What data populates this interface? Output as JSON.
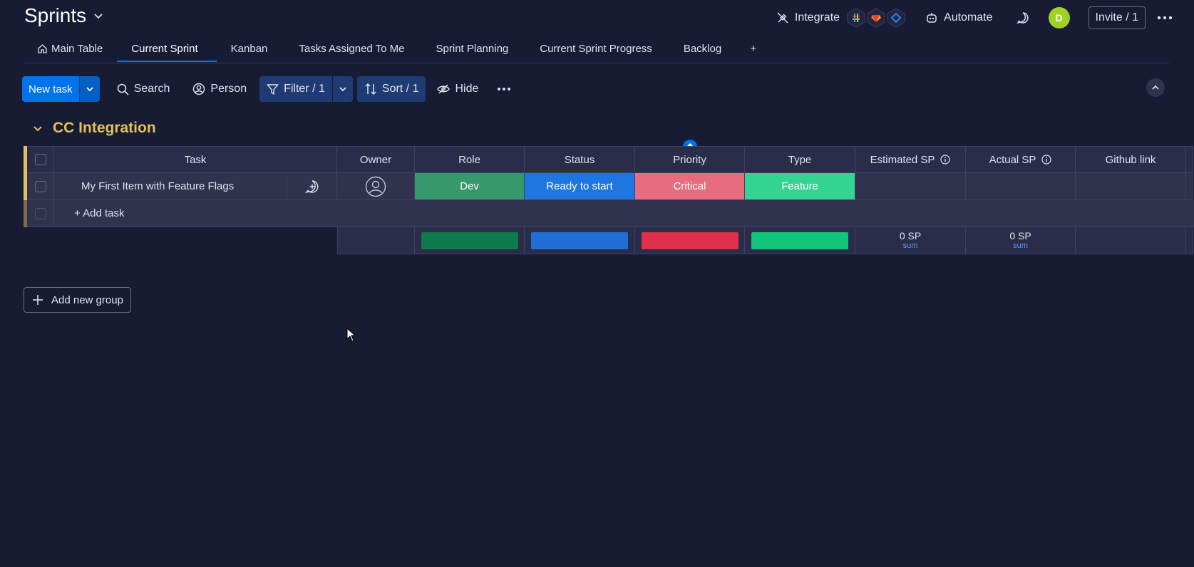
{
  "board": {
    "title": "Sprints"
  },
  "topbar": {
    "integrate_label": "Integrate",
    "automate_label": "Automate",
    "avatar_initial": "D",
    "invite_label": "Invite / 1"
  },
  "tabs": [
    {
      "label": "Main Table"
    },
    {
      "label": "Current Sprint"
    },
    {
      "label": "Kanban"
    },
    {
      "label": "Tasks Assigned To Me"
    },
    {
      "label": "Sprint Planning"
    },
    {
      "label": "Current Sprint Progress"
    },
    {
      "label": "Backlog"
    },
    {
      "label": "+"
    }
  ],
  "toolbar": {
    "new_task": "New task",
    "search": "Search",
    "person": "Person",
    "filter": "Filter / 1",
    "sort": "Sort / 1",
    "hide": "Hide"
  },
  "group": {
    "title": "CC Integration",
    "color": "#e2c15b",
    "columns": {
      "task": "Task",
      "owner": "Owner",
      "role": "Role",
      "status": "Status",
      "priority": "Priority",
      "type": "Type",
      "estimated_sp": "Estimated SP",
      "actual_sp": "Actual SP",
      "github_link": "Github link"
    },
    "rows": [
      {
        "task": "My First Item with Feature Flags",
        "role": "Dev",
        "role_color": "#37986c",
        "status": "Ready to start",
        "status_color": "#1f76e0",
        "priority": "Critical",
        "priority_color": "#e96b7e",
        "type": "Feature",
        "type_color": "#33d391"
      }
    ],
    "add_task": "+ Add task",
    "summary": {
      "estimated_sp": "0 SP",
      "estimated_sp_fn": "sum",
      "actual_sp": "0 SP",
      "actual_sp_fn": "sum",
      "role_bar_color": "#0f7a4e",
      "status_bar_color": "#1f6fd6",
      "priority_bar_color": "#df2f4a",
      "type_bar_color": "#13c57b"
    }
  },
  "add_group_label": "Add new group"
}
